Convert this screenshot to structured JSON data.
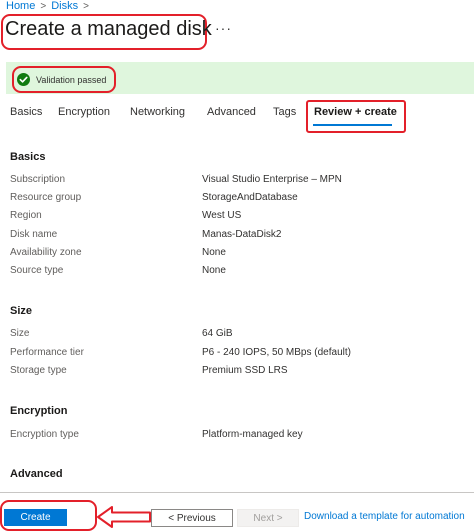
{
  "breadcrumb": {
    "home": "Home",
    "sep1": ">",
    "disks": "Disks",
    "sep2": ">"
  },
  "header": {
    "title": "Create a managed disk",
    "more": "···"
  },
  "validation": {
    "text": "Validation passed",
    "color": "#107c10"
  },
  "tabs": [
    {
      "label": "Basics"
    },
    {
      "label": "Encryption"
    },
    {
      "label": "Networking"
    },
    {
      "label": "Advanced"
    },
    {
      "label": "Tags"
    },
    {
      "label": "Review + create"
    }
  ],
  "sections": {
    "basics": {
      "title": "Basics",
      "rows": [
        {
          "label": "Subscription",
          "value": "Visual Studio Enterprise – MPN"
        },
        {
          "label": "Resource group",
          "value": "StorageAndDatabase"
        },
        {
          "label": "Region",
          "value": "West US"
        },
        {
          "label": "Disk name",
          "value": "Manas-DataDisk2"
        },
        {
          "label": "Availability zone",
          "value": "None"
        },
        {
          "label": "Source type",
          "value": "None"
        }
      ]
    },
    "size": {
      "title": "Size",
      "rows": [
        {
          "label": "Size",
          "value": "64 GiB"
        },
        {
          "label": "Performance tier",
          "value": "P6 - 240 IOPS, 50 MBps (default)"
        },
        {
          "label": "Storage type",
          "value": "Premium SSD LRS"
        }
      ]
    },
    "encryption": {
      "title": "Encryption",
      "rows": [
        {
          "label": "Encryption type",
          "value": "Platform-managed key"
        }
      ]
    },
    "advanced": {
      "title": "Advanced"
    }
  },
  "footer": {
    "create": "Create",
    "previous": "< Previous",
    "next": "Next >",
    "template_link": "Download a template for automation"
  }
}
